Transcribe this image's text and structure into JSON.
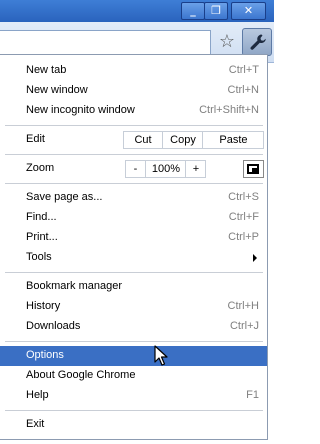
{
  "window": {
    "minimize_glyph": "_",
    "maximize_glyph": "❐",
    "close_glyph": "✕"
  },
  "toolbar": {
    "star_glyph": "☆",
    "bookmark_icon": "star-icon",
    "menu_icon": "wrench-icon"
  },
  "menu": {
    "new_tab": {
      "label": "New tab",
      "shortcut": "Ctrl+T"
    },
    "new_window": {
      "label": "New window",
      "shortcut": "Ctrl+N"
    },
    "new_incognito": {
      "label": "New incognito window",
      "shortcut": "Ctrl+Shift+N"
    },
    "edit": {
      "label": "Edit",
      "cut": "Cut",
      "copy": "Copy",
      "paste": "Paste"
    },
    "zoom": {
      "label": "Zoom",
      "minus": "-",
      "value": "100%",
      "plus": "+"
    },
    "save_page": {
      "label": "Save page as...",
      "shortcut": "Ctrl+S"
    },
    "find": {
      "label": "Find...",
      "shortcut": "Ctrl+F"
    },
    "print": {
      "label": "Print...",
      "shortcut": "Ctrl+P"
    },
    "tools": {
      "label": "Tools"
    },
    "bookmark_manager": {
      "label": "Bookmark manager"
    },
    "history": {
      "label": "History",
      "shortcut": "Ctrl+H"
    },
    "downloads": {
      "label": "Downloads",
      "shortcut": "Ctrl+J"
    },
    "options": {
      "label": "Options"
    },
    "about": {
      "label": "About Google Chrome"
    },
    "help": {
      "label": "Help",
      "shortcut": "F1"
    },
    "exit": {
      "label": "Exit"
    }
  },
  "colors": {
    "highlight": "#3a6fc4",
    "shortcut_text": "#808080",
    "titlebar": "#2a63bd"
  }
}
